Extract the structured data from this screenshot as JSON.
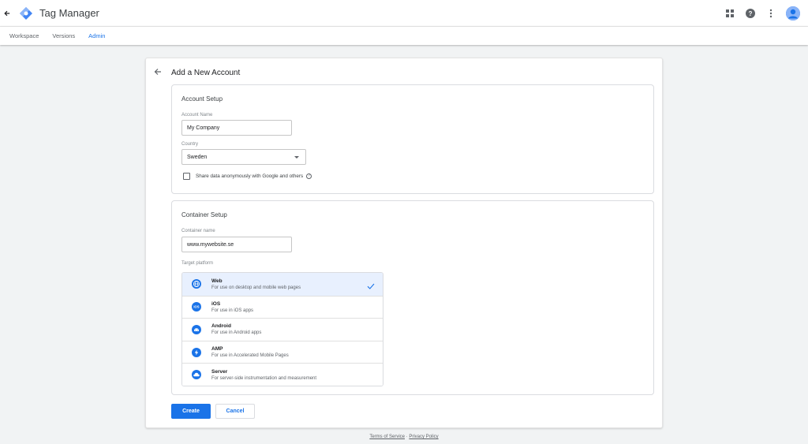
{
  "app": {
    "title": "Tag Manager"
  },
  "subnav": {
    "items": [
      {
        "label": "Workspace"
      },
      {
        "label": "Versions"
      },
      {
        "label": "Admin",
        "active": true
      }
    ]
  },
  "card": {
    "title": "Add a New Account"
  },
  "account_setup": {
    "title": "Account Setup",
    "account_name_label": "Account Name",
    "account_name_value": "My Company",
    "country_label": "Country",
    "country_value": "Sweden",
    "share_data_label": "Share data anonymously with Google and others",
    "share_data_checked": false
  },
  "container_setup": {
    "title": "Container Setup",
    "container_name_label": "Container name",
    "container_name_value": "www.mywebsite.se",
    "target_platform_label": "Target platform",
    "platforms": [
      {
        "name": "Web",
        "desc": "For use on desktop and mobile web pages",
        "icon": "globe-icon",
        "selected": true
      },
      {
        "name": "iOS",
        "desc": "For use in iOS apps",
        "icon": "ios-icon",
        "selected": false
      },
      {
        "name": "Android",
        "desc": "For use in Android apps",
        "icon": "android-icon",
        "selected": false
      },
      {
        "name": "AMP",
        "desc": "For use in Accelerated Mobile Pages",
        "icon": "amp-bolt-icon",
        "selected": false
      },
      {
        "name": "Server",
        "desc": "For server-side instrumentation and measurement",
        "icon": "cloud-icon",
        "selected": false
      }
    ]
  },
  "actions": {
    "create_label": "Create",
    "cancel_label": "Cancel"
  },
  "footer": {
    "terms": "Terms of Service",
    "separator": "·",
    "privacy": "Privacy Policy"
  },
  "colors": {
    "accent": "#1a73e8",
    "selected_bg": "#e8f0fe",
    "page_bg": "#f1f3f4"
  }
}
